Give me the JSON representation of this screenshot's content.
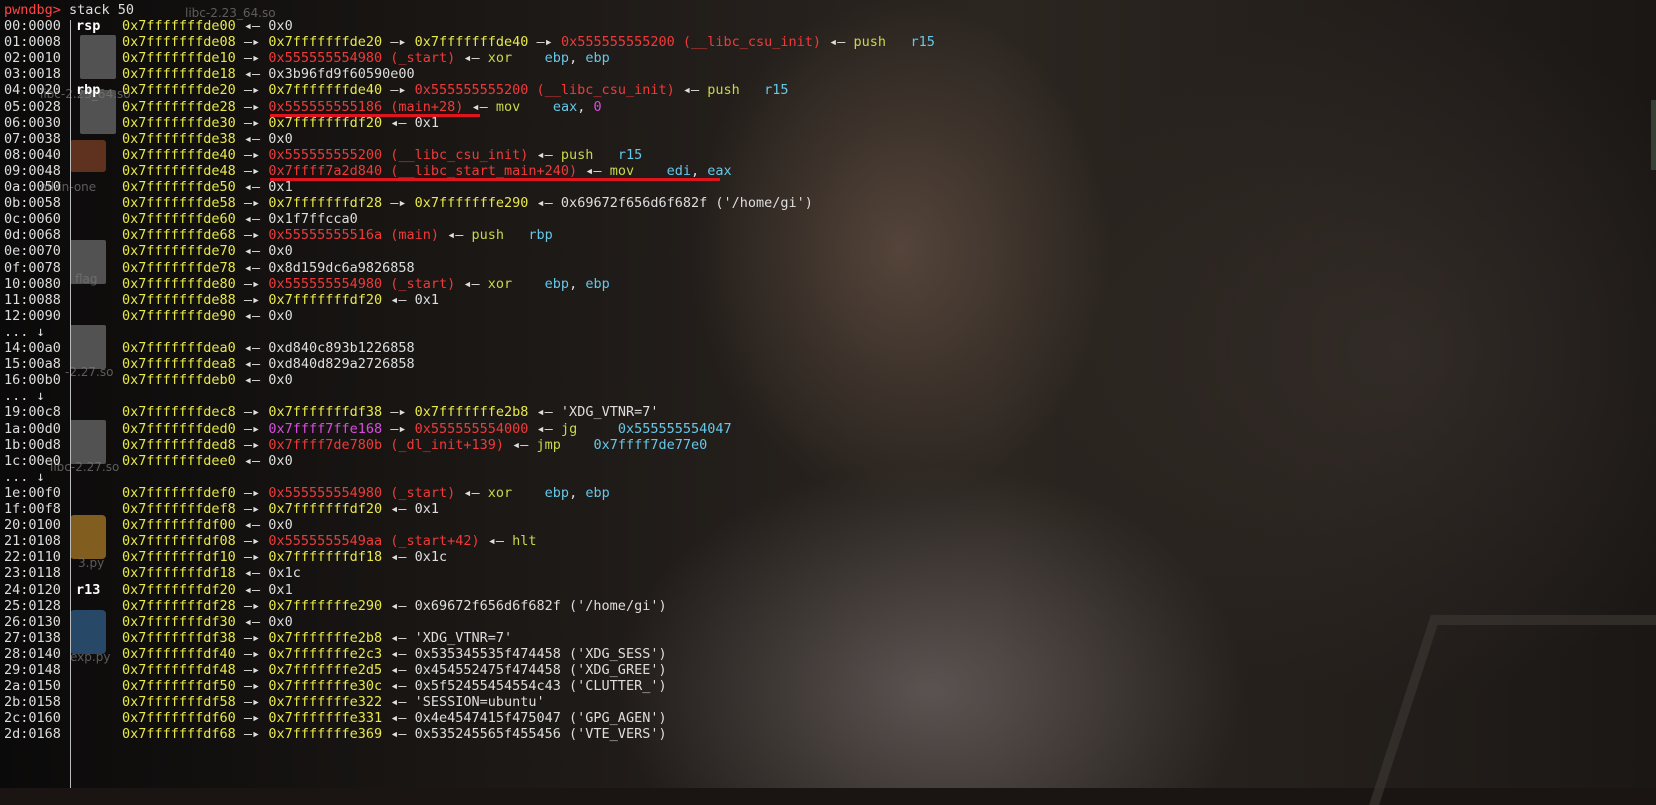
{
  "wallpaper": {
    "desktop_icons": [
      {
        "name": "libc-2.23_64.so",
        "kind": "doc"
      },
      {
        "name": "libc-2.23_64.so",
        "kind": "doc"
      },
      {
        "name": "all-in-one",
        "kind": "folder"
      },
      {
        "name": "flag",
        "kind": "doc"
      },
      {
        "name": "-2.27.so",
        "kind": "doc"
      },
      {
        "name": "libc-2.27.so",
        "kind": "doc"
      },
      {
        "name": "3.py",
        "kind": "py"
      },
      {
        "name": "exp.py",
        "kind": "py2"
      }
    ]
  },
  "terminal": {
    "prompt": "pwndbg>",
    "command": " stack 50",
    "lines": [
      {
        "off": "00:0000",
        "reg": "rsp",
        "segs": [
          [
            "y",
            "0x7fffffffde00"
          ],
          [
            "w",
            " ◂— 0x0"
          ]
        ]
      },
      {
        "off": "01:0008",
        "reg": "",
        "segs": [
          [
            "y",
            "0x7fffffffde08"
          ],
          [
            "w",
            " —▸ "
          ],
          [
            "y",
            "0x7fffffffde20"
          ],
          [
            "w",
            " —▸ "
          ],
          [
            "y",
            "0x7fffffffde40"
          ],
          [
            "w",
            " —▸ "
          ],
          [
            "r",
            "0x555555555200 (__libc_csu_init)"
          ],
          [
            "w",
            " ◂— "
          ],
          [
            "g",
            "push"
          ],
          [
            "w",
            "   "
          ],
          [
            "c",
            "r15"
          ]
        ]
      },
      {
        "off": "02:0010",
        "reg": "",
        "segs": [
          [
            "y",
            "0x7fffffffde10"
          ],
          [
            "w",
            " —▸ "
          ],
          [
            "r",
            "0x555555554980 (_start)"
          ],
          [
            "w",
            " ◂— "
          ],
          [
            "g",
            "xor"
          ],
          [
            "w",
            "    "
          ],
          [
            "c",
            "ebp"
          ],
          [
            "w",
            ", "
          ],
          [
            "c",
            "ebp"
          ]
        ]
      },
      {
        "off": "03:0018",
        "reg": "",
        "segs": [
          [
            "y",
            "0x7fffffffde18"
          ],
          [
            "w",
            " ◂— 0x3b96fd9f60590e00"
          ]
        ]
      },
      {
        "off": "04:0020",
        "reg": "rbp",
        "segs": [
          [
            "y",
            "0x7fffffffde20"
          ],
          [
            "w",
            " —▸ "
          ],
          [
            "y",
            "0x7fffffffde40"
          ],
          [
            "w",
            " —▸ "
          ],
          [
            "r",
            "0x555555555200 (__libc_csu_init)"
          ],
          [
            "w",
            " ◂— "
          ],
          [
            "g",
            "push"
          ],
          [
            "w",
            "   "
          ],
          [
            "c",
            "r15"
          ]
        ]
      },
      {
        "off": "05:0028",
        "reg": "",
        "segs": [
          [
            "y",
            "0x7fffffffde28"
          ],
          [
            "w",
            " —▸ "
          ],
          [
            "r",
            "0x555555555186 (main+28)"
          ],
          [
            "w",
            " ◂— "
          ],
          [
            "g",
            "mov"
          ],
          [
            "w",
            "    "
          ],
          [
            "c",
            "eax"
          ],
          [
            "w",
            ", "
          ],
          [
            "m",
            "0"
          ]
        ]
      },
      {
        "off": "06:0030",
        "reg": "",
        "segs": [
          [
            "y",
            "0x7fffffffde30"
          ],
          [
            "w",
            " —▸ "
          ],
          [
            "y",
            "0x7fffffffdf20"
          ],
          [
            "w",
            " ◂— 0x1"
          ]
        ]
      },
      {
        "off": "07:0038",
        "reg": "",
        "segs": [
          [
            "y",
            "0x7fffffffde38"
          ],
          [
            "w",
            " ◂— 0x0"
          ]
        ]
      },
      {
        "off": "08:0040",
        "reg": "",
        "segs": [
          [
            "y",
            "0x7fffffffde40"
          ],
          [
            "w",
            " —▸ "
          ],
          [
            "r",
            "0x555555555200 (__libc_csu_init)"
          ],
          [
            "w",
            " ◂— "
          ],
          [
            "g",
            "push"
          ],
          [
            "w",
            "   "
          ],
          [
            "c",
            "r15"
          ]
        ]
      },
      {
        "off": "09:0048",
        "reg": "",
        "segs": [
          [
            "y",
            "0x7fffffffde48"
          ],
          [
            "w",
            " —▸ "
          ],
          [
            "r",
            "0x7ffff7a2d840 (__libc_start_main+240)"
          ],
          [
            "w",
            " ◂— "
          ],
          [
            "g",
            "mov"
          ],
          [
            "w",
            "    "
          ],
          [
            "c",
            "edi"
          ],
          [
            "w",
            ", "
          ],
          [
            "c",
            "eax"
          ]
        ]
      },
      {
        "off": "0a:0050",
        "reg": "",
        "segs": [
          [
            "y",
            "0x7fffffffde50"
          ],
          [
            "w",
            " ◂— 0x1"
          ]
        ]
      },
      {
        "off": "0b:0058",
        "reg": "",
        "segs": [
          [
            "y",
            "0x7fffffffde58"
          ],
          [
            "w",
            " —▸ "
          ],
          [
            "y",
            "0x7fffffffdf28"
          ],
          [
            "w",
            " —▸ "
          ],
          [
            "y",
            "0x7fffffffe290"
          ],
          [
            "w",
            " ◂— 0x69672f656d6f682f ('/home/gi')"
          ]
        ]
      },
      {
        "off": "0c:0060",
        "reg": "",
        "segs": [
          [
            "y",
            "0x7fffffffde60"
          ],
          [
            "w",
            " ◂— 0x1f7ffcca0"
          ]
        ]
      },
      {
        "off": "0d:0068",
        "reg": "",
        "segs": [
          [
            "y",
            "0x7fffffffde68"
          ],
          [
            "w",
            " —▸ "
          ],
          [
            "r",
            "0x55555555516a (main)"
          ],
          [
            "w",
            " ◂— "
          ],
          [
            "g",
            "push"
          ],
          [
            "w",
            "   "
          ],
          [
            "c",
            "rbp"
          ]
        ]
      },
      {
        "off": "0e:0070",
        "reg": "",
        "segs": [
          [
            "y",
            "0x7fffffffde70"
          ],
          [
            "w",
            " ◂— 0x0"
          ]
        ]
      },
      {
        "off": "0f:0078",
        "reg": "",
        "segs": [
          [
            "y",
            "0x7fffffffde78"
          ],
          [
            "w",
            " ◂— 0x8d159dc6a9826858"
          ]
        ]
      },
      {
        "off": "10:0080",
        "reg": "",
        "segs": [
          [
            "y",
            "0x7fffffffde80"
          ],
          [
            "w",
            " —▸ "
          ],
          [
            "r",
            "0x555555554980 (_start)"
          ],
          [
            "w",
            " ◂— "
          ],
          [
            "g",
            "xor"
          ],
          [
            "w",
            "    "
          ],
          [
            "c",
            "ebp"
          ],
          [
            "w",
            ", "
          ],
          [
            "c",
            "ebp"
          ]
        ]
      },
      {
        "off": "11:0088",
        "reg": "",
        "segs": [
          [
            "y",
            "0x7fffffffde88"
          ],
          [
            "w",
            " —▸ "
          ],
          [
            "y",
            "0x7fffffffdf20"
          ],
          [
            "w",
            " ◂— 0x1"
          ]
        ]
      },
      {
        "off": "12:0090",
        "reg": "",
        "segs": [
          [
            "y",
            "0x7fffffffde90"
          ],
          [
            "w",
            " ◂— 0x0"
          ]
        ]
      },
      {
        "off": "... ↓",
        "reg": "",
        "segs": []
      },
      {
        "off": "14:00a0",
        "reg": "",
        "segs": [
          [
            "y",
            "0x7fffffffdea0"
          ],
          [
            "w",
            " ◂— 0xd840c893b1226858"
          ]
        ]
      },
      {
        "off": "15:00a8",
        "reg": "",
        "segs": [
          [
            "y",
            "0x7fffffffdea8"
          ],
          [
            "w",
            " ◂— 0xd840d829a2726858"
          ]
        ]
      },
      {
        "off": "16:00b0",
        "reg": "",
        "segs": [
          [
            "y",
            "0x7fffffffdeb0"
          ],
          [
            "w",
            " ◂— 0x0"
          ]
        ]
      },
      {
        "off": "... ↓",
        "reg": "",
        "segs": []
      },
      {
        "off": "19:00c8",
        "reg": "",
        "segs": [
          [
            "y",
            "0x7fffffffdec8"
          ],
          [
            "w",
            " —▸ "
          ],
          [
            "y",
            "0x7fffffffdf38"
          ],
          [
            "w",
            " —▸ "
          ],
          [
            "y",
            "0x7fffffffe2b8"
          ],
          [
            "w",
            " ◂— 'XDG_VTNR=7'"
          ]
        ]
      },
      {
        "off": "1a:00d0",
        "reg": "",
        "segs": [
          [
            "y",
            "0x7fffffffded0"
          ],
          [
            "w",
            " —▸ "
          ],
          [
            "m",
            "0x7ffff7ffe168"
          ],
          [
            "w",
            " —▸ "
          ],
          [
            "r",
            "0x555555554000"
          ],
          [
            "w",
            " ◂— "
          ],
          [
            "g",
            "jg"
          ],
          [
            "w",
            "     "
          ],
          [
            "c",
            "0x555555554047"
          ]
        ]
      },
      {
        "off": "1b:00d8",
        "reg": "",
        "segs": [
          [
            "y",
            "0x7fffffffded8"
          ],
          [
            "w",
            " —▸ "
          ],
          [
            "r",
            "0x7ffff7de780b (_dl_init+139)"
          ],
          [
            "w",
            " ◂— "
          ],
          [
            "g",
            "jmp"
          ],
          [
            "w",
            "    "
          ],
          [
            "c",
            "0x7ffff7de77e0"
          ]
        ]
      },
      {
        "off": "1c:00e0",
        "reg": "",
        "segs": [
          [
            "y",
            "0x7fffffffdee0"
          ],
          [
            "w",
            " ◂— 0x0"
          ]
        ]
      },
      {
        "off": "... ↓",
        "reg": "",
        "segs": []
      },
      {
        "off": "1e:00f0",
        "reg": "",
        "segs": [
          [
            "y",
            "0x7fffffffdef0"
          ],
          [
            "w",
            " —▸ "
          ],
          [
            "r",
            "0x555555554980 (_start)"
          ],
          [
            "w",
            " ◂— "
          ],
          [
            "g",
            "xor"
          ],
          [
            "w",
            "    "
          ],
          [
            "c",
            "ebp"
          ],
          [
            "w",
            ", "
          ],
          [
            "c",
            "ebp"
          ]
        ]
      },
      {
        "off": "1f:00f8",
        "reg": "",
        "segs": [
          [
            "y",
            "0x7fffffffdef8"
          ],
          [
            "w",
            " —▸ "
          ],
          [
            "y",
            "0x7fffffffdf20"
          ],
          [
            "w",
            " ◂— 0x1"
          ]
        ]
      },
      {
        "off": "20:0100",
        "reg": "",
        "segs": [
          [
            "y",
            "0x7fffffffdf00"
          ],
          [
            "w",
            " ◂— 0x0"
          ]
        ]
      },
      {
        "off": "21:0108",
        "reg": "",
        "segs": [
          [
            "y",
            "0x7fffffffdf08"
          ],
          [
            "w",
            " —▸ "
          ],
          [
            "r",
            "0x5555555549aa (_start+42)"
          ],
          [
            "w",
            " ◂— "
          ],
          [
            "g",
            "hlt"
          ]
        ]
      },
      {
        "off": "22:0110",
        "reg": "",
        "segs": [
          [
            "y",
            "0x7fffffffdf10"
          ],
          [
            "w",
            " —▸ "
          ],
          [
            "y",
            "0x7fffffffdf18"
          ],
          [
            "w",
            " ◂— 0x1c"
          ]
        ]
      },
      {
        "off": "23:0118",
        "reg": "",
        "segs": [
          [
            "y",
            "0x7fffffffdf18"
          ],
          [
            "w",
            " ◂— 0x1c"
          ]
        ]
      },
      {
        "off": "24:0120",
        "reg": "r13",
        "segs": [
          [
            "y",
            "0x7fffffffdf20"
          ],
          [
            "w",
            " ◂— 0x1"
          ]
        ]
      },
      {
        "off": "25:0128",
        "reg": "",
        "segs": [
          [
            "y",
            "0x7fffffffdf28"
          ],
          [
            "w",
            " —▸ "
          ],
          [
            "y",
            "0x7fffffffe290"
          ],
          [
            "w",
            " ◂— 0x69672f656d6f682f ('/home/gi')"
          ]
        ]
      },
      {
        "off": "26:0130",
        "reg": "",
        "segs": [
          [
            "y",
            "0x7fffffffdf30"
          ],
          [
            "w",
            " ◂— 0x0"
          ]
        ]
      },
      {
        "off": "27:0138",
        "reg": "",
        "segs": [
          [
            "y",
            "0x7fffffffdf38"
          ],
          [
            "w",
            " —▸ "
          ],
          [
            "y",
            "0x7fffffffe2b8"
          ],
          [
            "w",
            " ◂— 'XDG_VTNR=7'"
          ]
        ]
      },
      {
        "off": "28:0140",
        "reg": "",
        "segs": [
          [
            "y",
            "0x7fffffffdf40"
          ],
          [
            "w",
            " —▸ "
          ],
          [
            "y",
            "0x7fffffffe2c3"
          ],
          [
            "w",
            " ◂— 0x535345535f474458 ('XDG_SESS')"
          ]
        ]
      },
      {
        "off": "29:0148",
        "reg": "",
        "segs": [
          [
            "y",
            "0x7fffffffdf48"
          ],
          [
            "w",
            " —▸ "
          ],
          [
            "y",
            "0x7fffffffe2d5"
          ],
          [
            "w",
            " ◂— 0x454552475f474458 ('XDG_GREE')"
          ]
        ]
      },
      {
        "off": "2a:0150",
        "reg": "",
        "segs": [
          [
            "y",
            "0x7fffffffdf50"
          ],
          [
            "w",
            " —▸ "
          ],
          [
            "y",
            "0x7fffffffe30c"
          ],
          [
            "w",
            " ◂— 0x5f52455454554c43 ('CLUTTER_')"
          ]
        ]
      },
      {
        "off": "2b:0158",
        "reg": "",
        "segs": [
          [
            "y",
            "0x7fffffffdf58"
          ],
          [
            "w",
            " —▸ "
          ],
          [
            "y",
            "0x7fffffffe322"
          ],
          [
            "w",
            " ◂— 'SESSION=ubuntu'"
          ]
        ]
      },
      {
        "off": "2c:0160",
        "reg": "",
        "segs": [
          [
            "y",
            "0x7fffffffdf60"
          ],
          [
            "w",
            " —▸ "
          ],
          [
            "y",
            "0x7fffffffe331"
          ],
          [
            "w",
            " ◂— 0x4e4547415f475047 ('GPG_AGEN')"
          ]
        ]
      },
      {
        "off": "2d:0168",
        "reg": "",
        "segs": [
          [
            "y",
            "0x7fffffffdf68"
          ],
          [
            "w",
            " —▸ "
          ],
          [
            "y",
            "0x7fffffffe369"
          ],
          [
            "w",
            " ◂— 0x535245565f455456 ('VTE_VERS')"
          ]
        ]
      }
    ]
  },
  "annotations": {
    "underline_color": "#e0141e"
  }
}
